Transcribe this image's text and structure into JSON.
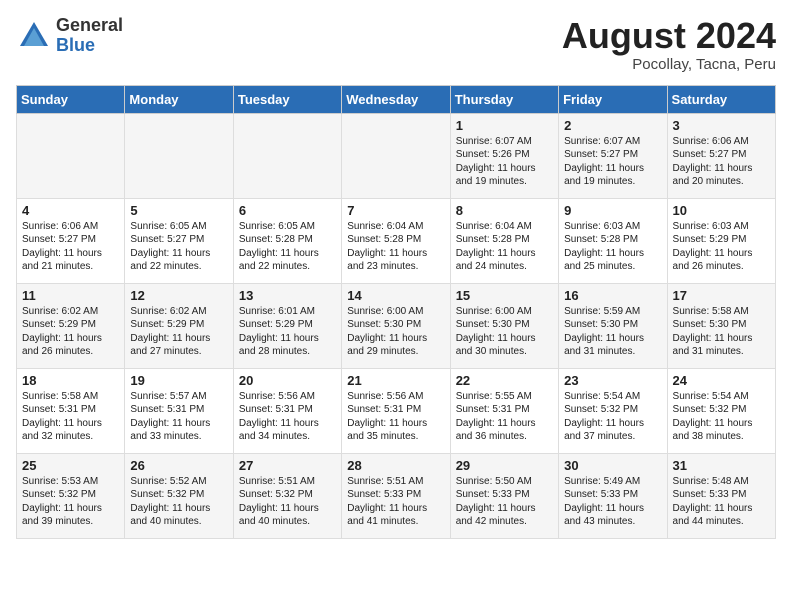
{
  "header": {
    "logo_general": "General",
    "logo_blue": "Blue",
    "month_year": "August 2024",
    "location": "Pocollay, Tacna, Peru"
  },
  "weekdays": [
    "Sunday",
    "Monday",
    "Tuesday",
    "Wednesday",
    "Thursday",
    "Friday",
    "Saturday"
  ],
  "weeks": [
    [
      {
        "day": "",
        "info": ""
      },
      {
        "day": "",
        "info": ""
      },
      {
        "day": "",
        "info": ""
      },
      {
        "day": "",
        "info": ""
      },
      {
        "day": "1",
        "info": "Sunrise: 6:07 AM\nSunset: 5:26 PM\nDaylight: 11 hours\nand 19 minutes."
      },
      {
        "day": "2",
        "info": "Sunrise: 6:07 AM\nSunset: 5:27 PM\nDaylight: 11 hours\nand 19 minutes."
      },
      {
        "day": "3",
        "info": "Sunrise: 6:06 AM\nSunset: 5:27 PM\nDaylight: 11 hours\nand 20 minutes."
      }
    ],
    [
      {
        "day": "4",
        "info": "Sunrise: 6:06 AM\nSunset: 5:27 PM\nDaylight: 11 hours\nand 21 minutes."
      },
      {
        "day": "5",
        "info": "Sunrise: 6:05 AM\nSunset: 5:27 PM\nDaylight: 11 hours\nand 22 minutes."
      },
      {
        "day": "6",
        "info": "Sunrise: 6:05 AM\nSunset: 5:28 PM\nDaylight: 11 hours\nand 22 minutes."
      },
      {
        "day": "7",
        "info": "Sunrise: 6:04 AM\nSunset: 5:28 PM\nDaylight: 11 hours\nand 23 minutes."
      },
      {
        "day": "8",
        "info": "Sunrise: 6:04 AM\nSunset: 5:28 PM\nDaylight: 11 hours\nand 24 minutes."
      },
      {
        "day": "9",
        "info": "Sunrise: 6:03 AM\nSunset: 5:28 PM\nDaylight: 11 hours\nand 25 minutes."
      },
      {
        "day": "10",
        "info": "Sunrise: 6:03 AM\nSunset: 5:29 PM\nDaylight: 11 hours\nand 26 minutes."
      }
    ],
    [
      {
        "day": "11",
        "info": "Sunrise: 6:02 AM\nSunset: 5:29 PM\nDaylight: 11 hours\nand 26 minutes."
      },
      {
        "day": "12",
        "info": "Sunrise: 6:02 AM\nSunset: 5:29 PM\nDaylight: 11 hours\nand 27 minutes."
      },
      {
        "day": "13",
        "info": "Sunrise: 6:01 AM\nSunset: 5:29 PM\nDaylight: 11 hours\nand 28 minutes."
      },
      {
        "day": "14",
        "info": "Sunrise: 6:00 AM\nSunset: 5:30 PM\nDaylight: 11 hours\nand 29 minutes."
      },
      {
        "day": "15",
        "info": "Sunrise: 6:00 AM\nSunset: 5:30 PM\nDaylight: 11 hours\nand 30 minutes."
      },
      {
        "day": "16",
        "info": "Sunrise: 5:59 AM\nSunset: 5:30 PM\nDaylight: 11 hours\nand 31 minutes."
      },
      {
        "day": "17",
        "info": "Sunrise: 5:58 AM\nSunset: 5:30 PM\nDaylight: 11 hours\nand 31 minutes."
      }
    ],
    [
      {
        "day": "18",
        "info": "Sunrise: 5:58 AM\nSunset: 5:31 PM\nDaylight: 11 hours\nand 32 minutes."
      },
      {
        "day": "19",
        "info": "Sunrise: 5:57 AM\nSunset: 5:31 PM\nDaylight: 11 hours\nand 33 minutes."
      },
      {
        "day": "20",
        "info": "Sunrise: 5:56 AM\nSunset: 5:31 PM\nDaylight: 11 hours\nand 34 minutes."
      },
      {
        "day": "21",
        "info": "Sunrise: 5:56 AM\nSunset: 5:31 PM\nDaylight: 11 hours\nand 35 minutes."
      },
      {
        "day": "22",
        "info": "Sunrise: 5:55 AM\nSunset: 5:31 PM\nDaylight: 11 hours\nand 36 minutes."
      },
      {
        "day": "23",
        "info": "Sunrise: 5:54 AM\nSunset: 5:32 PM\nDaylight: 11 hours\nand 37 minutes."
      },
      {
        "day": "24",
        "info": "Sunrise: 5:54 AM\nSunset: 5:32 PM\nDaylight: 11 hours\nand 38 minutes."
      }
    ],
    [
      {
        "day": "25",
        "info": "Sunrise: 5:53 AM\nSunset: 5:32 PM\nDaylight: 11 hours\nand 39 minutes."
      },
      {
        "day": "26",
        "info": "Sunrise: 5:52 AM\nSunset: 5:32 PM\nDaylight: 11 hours\nand 40 minutes."
      },
      {
        "day": "27",
        "info": "Sunrise: 5:51 AM\nSunset: 5:32 PM\nDaylight: 11 hours\nand 40 minutes."
      },
      {
        "day": "28",
        "info": "Sunrise: 5:51 AM\nSunset: 5:33 PM\nDaylight: 11 hours\nand 41 minutes."
      },
      {
        "day": "29",
        "info": "Sunrise: 5:50 AM\nSunset: 5:33 PM\nDaylight: 11 hours\nand 42 minutes."
      },
      {
        "day": "30",
        "info": "Sunrise: 5:49 AM\nSunset: 5:33 PM\nDaylight: 11 hours\nand 43 minutes."
      },
      {
        "day": "31",
        "info": "Sunrise: 5:48 AM\nSunset: 5:33 PM\nDaylight: 11 hours\nand 44 minutes."
      }
    ]
  ]
}
